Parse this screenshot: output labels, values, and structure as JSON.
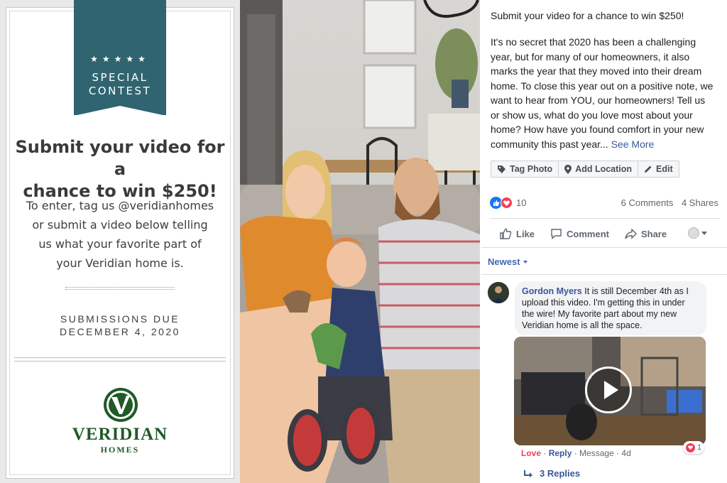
{
  "promo": {
    "ribbon_stars": "★★★★★",
    "ribbon_line1": "SPECIAL",
    "ribbon_line2": "CONTEST",
    "headline_line1": "Submit your video for a",
    "headline_line2": "chance to win $250!",
    "body_lines": [
      "To enter, tag us @veridianhomes",
      "or submit a video below telling",
      "us what your favorite part of",
      "your Veridian home is."
    ],
    "due_line1": "SUBMISSIONS DUE",
    "due_line2": "DECEMBER 4, 2020",
    "logo_name": "VERIDIAN",
    "logo_sub": "HOMES",
    "brand_color": "#2f6470",
    "logo_color": "#1f5a27"
  },
  "post": {
    "title": "Submit your video for a chance to win $250!",
    "body_lines": [
      "It's no secret that 2020 has been a challenging",
      "year, but for many of our homeowners, it also",
      "marks the year that they moved into their dream",
      "home. To close this year out on a positive note, we",
      "want to hear from YOU, our homeowners! Tell us",
      "or show us, what do you love most about your",
      "home? How have you found comfort in your new"
    ],
    "body_last": "community this past year...",
    "see_more": "See More",
    "tag_photo": "Tag Photo",
    "add_location": "Add Location",
    "edit": "Edit",
    "reaction_count": "10",
    "comments": "6 Comments",
    "shares": "4 Shares",
    "like": "Like",
    "comment": "Comment",
    "share": "Share",
    "sort": "Newest"
  },
  "comment": {
    "author": "Gordon Myers",
    "text_first": "It is still December 4th as I",
    "text_lines": [
      "upload this video. I'm getting this in under",
      "the wire! My favorite part about my new",
      "Veridian home is all the space."
    ],
    "love": "Love",
    "reply": "Reply",
    "message": "Message",
    "age": "4d",
    "love_count": "1",
    "replies": "3 Replies"
  }
}
